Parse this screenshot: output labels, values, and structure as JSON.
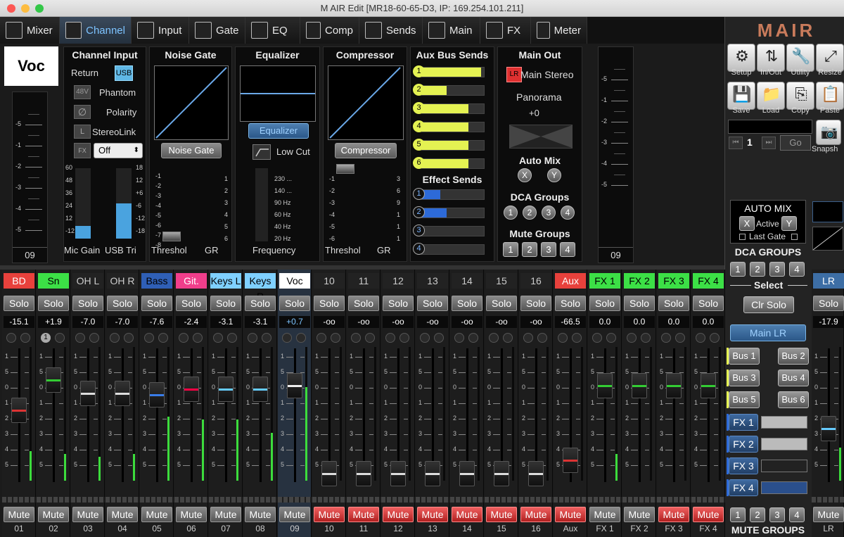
{
  "window": {
    "title": "M AIR Edit [MR18-60-65-D3, IP: 169.254.101.211]"
  },
  "tabs": [
    {
      "label": "Mixer"
    },
    {
      "label": "Channel"
    },
    {
      "label": "Input"
    },
    {
      "label": "Gate"
    },
    {
      "label": "EQ"
    },
    {
      "label": "Comp"
    },
    {
      "label": "Sends"
    },
    {
      "label": "Main"
    },
    {
      "label": "FX"
    },
    {
      "label": "Meter"
    }
  ],
  "channel_view": {
    "name": "Voc",
    "left_meter_num": "09",
    "right_meter_num": "09",
    "meter_scale": [
      "-5",
      "-1",
      "-2",
      "-3",
      "-4",
      "-5"
    ],
    "input": {
      "title": "Channel Input",
      "return_label": "Return",
      "usb": "USB",
      "phantom_badge": "48V",
      "phantom": "Phantom",
      "polarity": "Polarity",
      "stereolink_badge": "L",
      "stereolink": "StereoLink",
      "fx_badge": "FX",
      "fx_value": "Off",
      "left_scale": [
        "60",
        "48",
        "36",
        "24",
        "12",
        "-12"
      ],
      "right_scale": [
        "18",
        "12",
        "+6",
        "-6",
        "-12",
        "-18"
      ],
      "footer_l": "Mic Gain",
      "footer_r": "USB Tri"
    },
    "gate": {
      "title": "Noise Gate",
      "button": "Noise Gate",
      "scale": [
        "-1",
        "-2",
        "-3",
        "-4",
        "-5",
        "-6",
        "-7",
        "-8"
      ],
      "gr": [
        "1",
        "2",
        "3",
        "4",
        "5",
        "6"
      ],
      "footer_l": "Threshol",
      "footer_r": "GR"
    },
    "eq": {
      "title": "Equalizer",
      "button": "Equalizer",
      "lowcut": "Low Cut",
      "freqs": [
        "230 ...",
        "140 ...",
        "90 Hz",
        "60 Hz",
        "40 Hz",
        "20 Hz"
      ],
      "footer": "Frequency"
    },
    "comp": {
      "title": "Compressor",
      "button": "Compressor",
      "scale": [
        "-1",
        "-2",
        "-3",
        "-4",
        "-5",
        "-6"
      ],
      "gr": [
        "3",
        "6",
        "9",
        "1",
        "1",
        "1"
      ],
      "footer_l": "Threshol",
      "footer_r": "GR"
    },
    "sends": {
      "title": "Aux Bus Sends",
      "aux": [
        {
          "n": "1",
          "level": 0.95
        },
        {
          "n": "2",
          "level": 0.4
        },
        {
          "n": "3",
          "level": 0.75
        },
        {
          "n": "4",
          "level": 0.75
        },
        {
          "n": "5",
          "level": 0.75
        },
        {
          "n": "6",
          "level": 0.75
        }
      ],
      "fx_title": "Effect Sends",
      "fx": [
        {
          "n": "1",
          "level": 0.3
        },
        {
          "n": "2",
          "level": 0.4
        },
        {
          "n": "3",
          "level": 0
        },
        {
          "n": "4",
          "level": 0
        }
      ]
    },
    "main": {
      "title": "Main Out",
      "lr_badge": "LR",
      "stereo": "Main Stereo",
      "panorama": "Panorama",
      "pan_value": "+0",
      "automix": "Auto Mix",
      "x": "X",
      "y": "Y",
      "dca": "DCA Groups",
      "dca_nums": [
        "1",
        "2",
        "3",
        "4"
      ],
      "mute": "Mute Groups",
      "mute_nums": [
        "1",
        "2",
        "3",
        "4"
      ]
    }
  },
  "strips": [
    {
      "name": "BD",
      "color": "#e8413c",
      "text": "#fff",
      "gain": "-15.1",
      "label": "01",
      "fader": 0.56,
      "meter": 0.22,
      "cap": "#d33"
    },
    {
      "name": "Sn",
      "color": "#3ce046",
      "text": "#000",
      "gain": "+1.9",
      "label": "02",
      "fader": 0.83,
      "meter": 0.2,
      "cap": "#3c3",
      "badge": "1"
    },
    {
      "name": "OH L",
      "color": "#222",
      "text": "#ccc",
      "gain": "-7.0",
      "label": "03",
      "fader": 0.71,
      "meter": 0.18,
      "cap": "#ddd"
    },
    {
      "name": "OH R",
      "color": "#222",
      "text": "#ccc",
      "gain": "-7.0",
      "label": "04",
      "fader": 0.71,
      "meter": 0.2,
      "cap": "#ddd"
    },
    {
      "name": "Bass",
      "color": "#2f5fb6",
      "text": "#000",
      "gain": "-7.6",
      "label": "05",
      "fader": 0.7,
      "meter": 0.48,
      "cap": "#3a7de8"
    },
    {
      "name": "Git.",
      "color": "#f03e8b",
      "text": "#fff",
      "gain": "-2.4",
      "label": "06",
      "fader": 0.75,
      "meter": 0.46,
      "cap": "#f04"
    },
    {
      "name": "Keys L",
      "color": "#7fd0ff",
      "text": "#000",
      "gain": "-3.1",
      "label": "07",
      "fader": 0.75,
      "meter": 0.46,
      "cap": "#6cf"
    },
    {
      "name": "Keys R",
      "color": "#7fd0ff",
      "text": "#000",
      "gain": "-3.1",
      "label": "08",
      "fader": 0.75,
      "meter": 0.36,
      "cap": "#6cf"
    },
    {
      "name": "Voc",
      "color": "#fff",
      "text": "#000",
      "gain": "+0.7",
      "label": "09",
      "fader": 0.78,
      "meter": 0.7,
      "cap": "#eee",
      "sel": true
    },
    {
      "name": "10",
      "color": "#222",
      "text": "#ccc",
      "gain": "-oo",
      "label": "10",
      "fader": 0,
      "meter": 0,
      "cap": "#ddd",
      "muted": true
    },
    {
      "name": "11",
      "color": "#222",
      "text": "#ccc",
      "gain": "-oo",
      "label": "11",
      "fader": 0,
      "meter": 0,
      "cap": "#ddd",
      "muted": true
    },
    {
      "name": "12",
      "color": "#222",
      "text": "#ccc",
      "gain": "-oo",
      "label": "12",
      "fader": 0,
      "meter": 0,
      "cap": "#ddd",
      "muted": true
    },
    {
      "name": "13",
      "color": "#222",
      "text": "#ccc",
      "gain": "-oo",
      "label": "13",
      "fader": 0,
      "meter": 0,
      "cap": "#ddd",
      "muted": true
    },
    {
      "name": "14",
      "color": "#222",
      "text": "#ccc",
      "gain": "-oo",
      "label": "14",
      "fader": 0,
      "meter": 0,
      "cap": "#ddd",
      "muted": true
    },
    {
      "name": "15",
      "color": "#222",
      "text": "#ccc",
      "gain": "-oo",
      "label": "15",
      "fader": 0,
      "meter": 0,
      "cap": "#ddd",
      "muted": true
    },
    {
      "name": "16",
      "color": "#222",
      "text": "#ccc",
      "gain": "-oo",
      "label": "16",
      "fader": 0,
      "meter": 0,
      "cap": "#ddd",
      "muted": true
    },
    {
      "name": "Aux",
      "color": "#e8413c",
      "text": "#fff",
      "gain": "-66.5",
      "label": "Aux",
      "fader": 0.12,
      "meter": 0,
      "cap": "#d33",
      "muted": true
    },
    {
      "name": "FX 1",
      "color": "#3ce046",
      "text": "#000",
      "gain": "0.0",
      "label": "FX 1",
      "fader": 0.78,
      "meter": 0.2,
      "cap": "#3c3"
    },
    {
      "name": "FX 2",
      "color": "#3ce046",
      "text": "#000",
      "gain": "0.0",
      "label": "FX 2",
      "fader": 0.78,
      "meter": 0,
      "cap": "#3c3"
    },
    {
      "name": "FX 3",
      "color": "#3ce046",
      "text": "#000",
      "gain": "0.0",
      "label": "FX 3",
      "fader": 0.78,
      "meter": 0,
      "cap": "#3c3",
      "muted": true
    },
    {
      "name": "FX 4",
      "color": "#3ce046",
      "text": "#000",
      "gain": "0.0",
      "label": "FX 4",
      "fader": 0.78,
      "meter": 0,
      "cap": "#3c3",
      "muted": true
    }
  ],
  "strip_labels": {
    "solo": "Solo",
    "mute": "Mute",
    "scale": [
      "1",
      "5",
      "0",
      "1",
      "2",
      "3",
      "4",
      "5"
    ]
  },
  "lr_strip": {
    "name": "LR",
    "gain": "-17.9",
    "label": "LR",
    "solo": "Solo",
    "mute": "Mute",
    "fader": 0.4,
    "meter": 0.25
  },
  "right_panel": {
    "logo": "MAIR",
    "buttons": [
      "Setup",
      "In/Out",
      "Utility",
      "Resize",
      "Save",
      "Load",
      "Copy",
      "Paste"
    ],
    "snap_num": "1",
    "go": "Go",
    "snapshot": "Snapsh",
    "automix_title": "AUTO MIX",
    "automix_x": "X",
    "automix_y": "Y",
    "automix_active": "Active",
    "last_gate": "Last Gate",
    "dca_title": "DCA GROUPS",
    "dca_nums": [
      "1",
      "2",
      "3",
      "4"
    ],
    "select": "Select",
    "clr_solo": "Clr Solo",
    "main_lr": "Main LR",
    "bus": [
      "Bus 1",
      "Bus 2",
      "Bus 3",
      "Bus 4",
      "Bus 5",
      "Bus 6"
    ],
    "fx": [
      "FX 1",
      "FX 2",
      "FX 3",
      "FX 4"
    ],
    "mute_nums": [
      "1",
      "2",
      "3",
      "4"
    ],
    "mute_title": "MUTE GROUPS"
  }
}
